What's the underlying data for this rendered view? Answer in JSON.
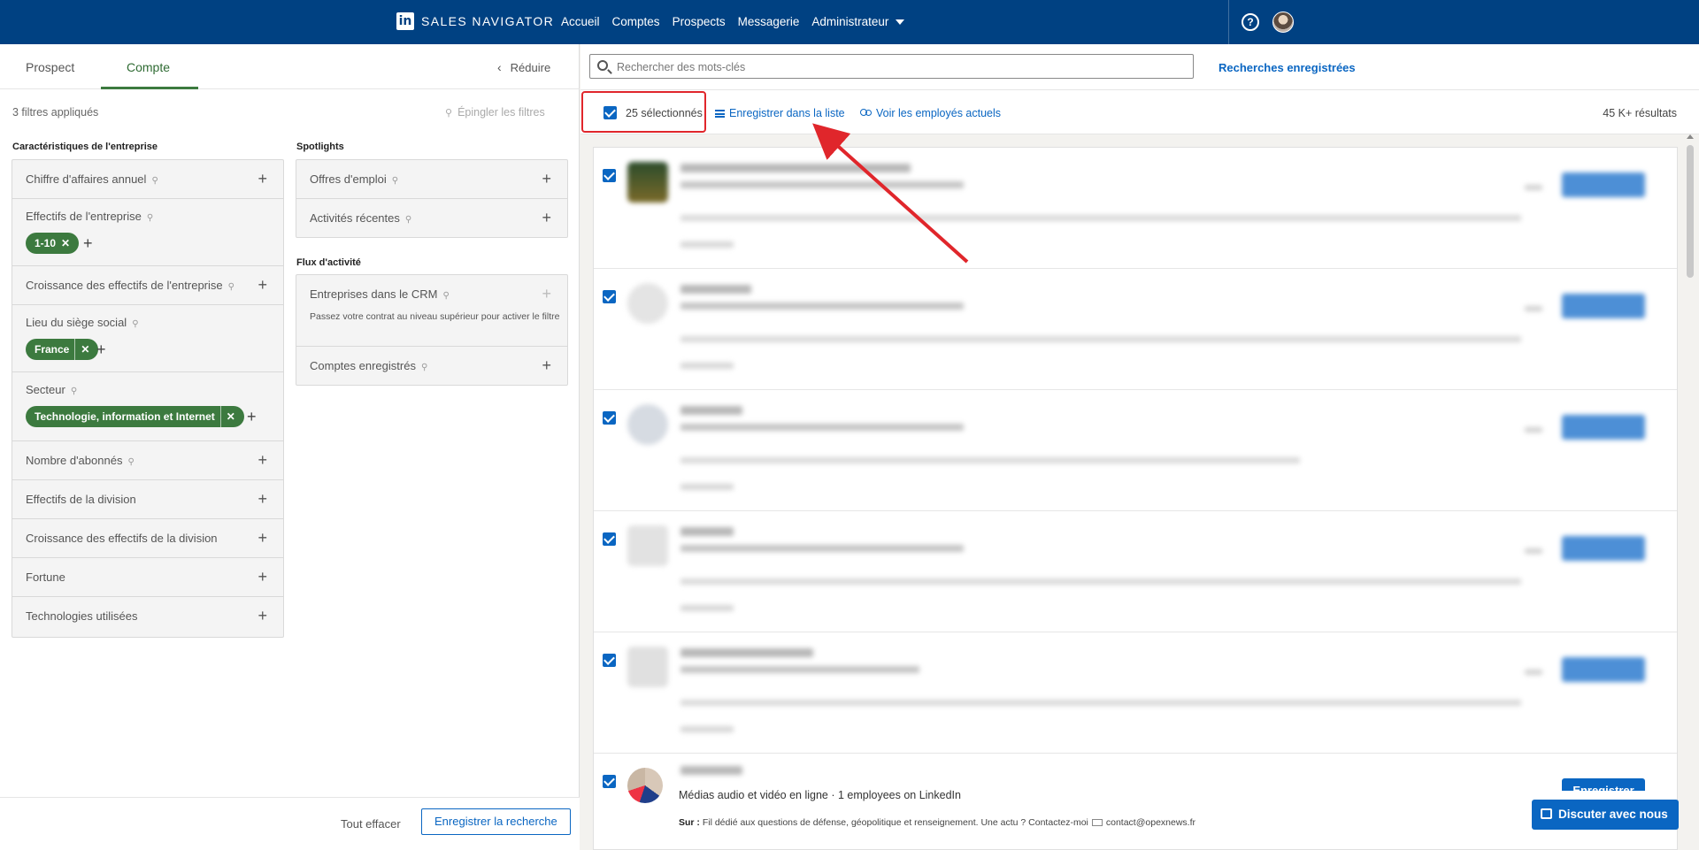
{
  "topnav": {
    "brand": "SALES NAVIGATOR",
    "links": [
      "Accueil",
      "Comptes",
      "Prospects",
      "Messagerie",
      "Administrateur"
    ],
    "help_icon": "?",
    "colors": {
      "bg": "#004182"
    }
  },
  "left": {
    "tabs": [
      "Prospect",
      "Compte"
    ],
    "active_tab": "Compte",
    "reduce": "Réduire",
    "filters_applied": "3 filtres appliqués",
    "pin_filters": "Épingler les filtres",
    "sections": {
      "company": "Caractéristiques de l'entreprise",
      "spotlights": "Spotlights",
      "activity": "Flux d'activité"
    },
    "company_filters": [
      {
        "label": "Chiffre d'affaires annuel"
      },
      {
        "label": "Effectifs de l'entreprise",
        "chip": "1-10"
      },
      {
        "label": "Croissance des effectifs de l'entreprise"
      },
      {
        "label": "Lieu du siège social",
        "chip": "France"
      },
      {
        "label": "Secteur",
        "chip": "Technologie, information et Internet"
      },
      {
        "label": "Nombre d'abonnés"
      },
      {
        "label": "Effectifs de la division"
      },
      {
        "label": "Croissance des effectifs de la division"
      },
      {
        "label": "Fortune"
      },
      {
        "label": "Technologies utilisées"
      }
    ],
    "spotlight_filters": [
      {
        "label": "Offres d'emploi"
      },
      {
        "label": "Activités récentes"
      }
    ],
    "activity_filters": [
      {
        "label": "Entreprises dans le CRM",
        "sub": "Passez votre contrat au niveau supérieur pour activer le filtre"
      },
      {
        "label": "Comptes enregistrés"
      }
    ],
    "clear_all": "Tout effacer",
    "save_search": "Enregistrer la recherche"
  },
  "right": {
    "search_placeholder": "Rechercher des mots-clés",
    "saved_searches": "Recherches enregistrées",
    "selected": "25 sélectionnés",
    "save_to_list": "Enregistrer dans la liste",
    "view_employees": "Voir les employés actuels",
    "results_count": "45 K+ résultats",
    "last_result": {
      "subtitle": "Médias audio et vidéo en ligne · 1 employees on LinkedIn",
      "desc_label": "Sur :",
      "desc": "Fil dédié aux questions de défense, géopolitique et renseignement. Une actu ? Contactez-moi",
      "email": "contact@opexnews.fr",
      "button": "Enregistrer"
    }
  },
  "chat": "Discuter avec nous",
  "colors": {
    "accent_green": "#3c7a3f",
    "link_blue": "#0a66c2",
    "highlight_red": "#e0262b"
  }
}
